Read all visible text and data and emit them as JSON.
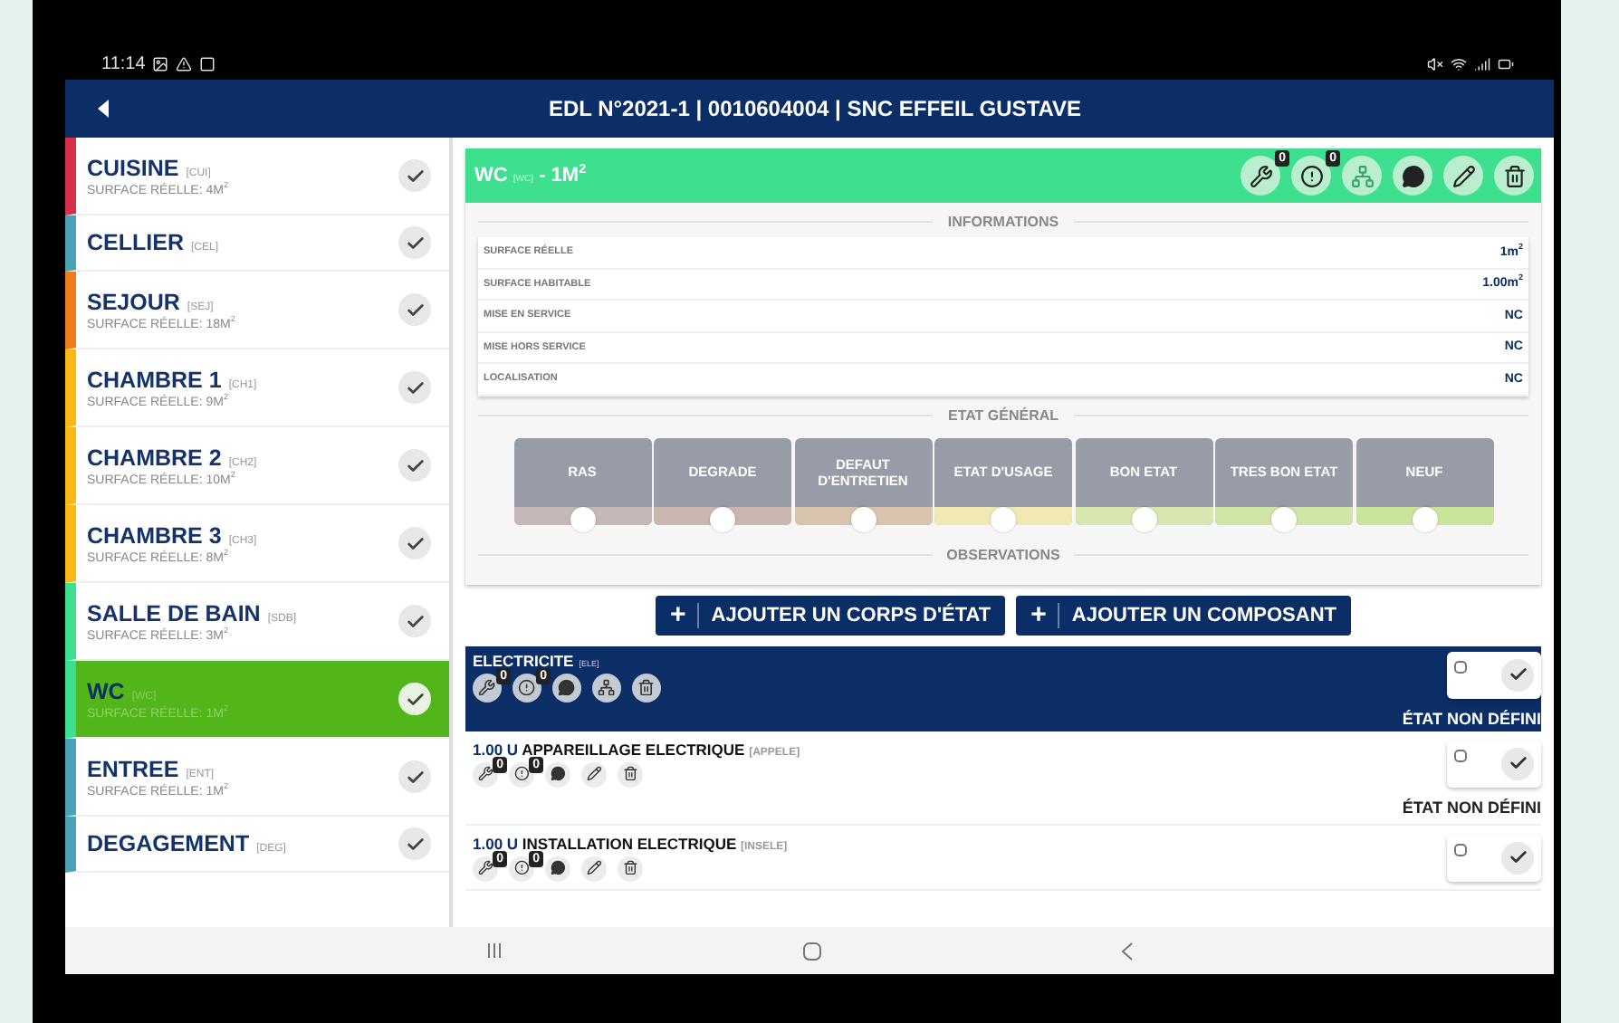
{
  "status_bar": {
    "time": "11:14"
  },
  "header": {
    "title": "EDL N°2021-1 | 0010604004 | SNC EFFEIL GUSTAVE"
  },
  "rooms": [
    {
      "name": "CUISINE",
      "code": "[CUI]",
      "surface": "SURFACE RÉELLE: 4M$^{2}$",
      "color": "#d9304a",
      "selected": false
    },
    {
      "name": "CELLIER",
      "code": "[CEL]",
      "color": "#4aa3b5",
      "selected": false
    },
    {
      "name": "SEJOUR",
      "code": "[SEJ]",
      "surface": "SURFACE RÉELLE: 18M$^{2}$",
      "color": "#f07d1c",
      "selected": false
    },
    {
      "name": "CHAMBRE 1",
      "code": "[CH1]",
      "surface": "SURFACE RÉELLE: 9M$^{2}$",
      "color": "#f7b917",
      "selected": false
    },
    {
      "name": "CHAMBRE 2",
      "code": "[CH2]",
      "surface": "SURFACE RÉELLE: 10M$^{2}$",
      "color": "#f7b917",
      "selected": false
    },
    {
      "name": "CHAMBRE 3",
      "code": "[CH3]",
      "surface": "SURFACE RÉELLE: 8M$^{2}$",
      "color": "#f7b917",
      "selected": false
    },
    {
      "name": "SALLE DE BAIN",
      "code": "[SDB]",
      "surface": "SURFACE RÉELLE: 3M$^{2}$",
      "color": "#3ee08f",
      "selected": false
    },
    {
      "name": "WC",
      "code": "[WC]",
      "surface": "SURFACE RÉELLE: 1M$^{2}$",
      "color": "#3ee08f",
      "selected": true
    },
    {
      "name": "ENTREE",
      "code": "[ENT]",
      "surface": "SURFACE RÉELLE: 1M$^{2}$",
      "color": "#4aa3b5",
      "selected": false
    },
    {
      "name": "DEGAGEMENT",
      "code": "[DEG]",
      "color": "#4aa3b5",
      "selected": false
    }
  ],
  "room_detail": {
    "name": "WC",
    "code": "[WC]",
    "area": "- 1M$^{2}$",
    "badges": [
      "0",
      "0"
    ],
    "information_title": "INFORMATIONS",
    "information": [
      {
        "label": "SURFACE RÉELLE",
        "value": "1m$^{2}$"
      },
      {
        "label": "SURFACE HABITABLE",
        "value": "1.00m$^{2}$"
      },
      {
        "label": "MISE EN SERVICE",
        "value": "NC"
      },
      {
        "label": "MISE HORS SERVICE",
        "value": "NC"
      },
      {
        "label": "LOCALISATION",
        "value": "NC"
      }
    ],
    "etat_title": "ETAT GÉNÉRAL",
    "etat_options": [
      {
        "label": "RAS",
        "color": "#c3b8b5",
        "selected": false
      },
      {
        "label": "DEGRADE",
        "color": "#c9b6ae",
        "selected": false
      },
      {
        "label": "DEFAUT D'ENTRETIEN",
        "color": "#d8c4ad",
        "selected": false
      },
      {
        "label": "ETAT D'USAGE",
        "color": "#f1e9b3",
        "selected": false
      },
      {
        "label": "BON ETAT",
        "color": "#d8e6b0",
        "selected": false
      },
      {
        "label": "TRES BON ETAT",
        "color": "#cfe5a5",
        "selected": false
      },
      {
        "label": "NEUF",
        "color": "#c8e59a",
        "selected": false
      }
    ],
    "observations_title": "OBSERVATIONS"
  },
  "actions": [
    {
      "icon": "+",
      "label": "AJOUTER UN CORPS D'ÉTAT"
    },
    {
      "icon": "+",
      "label": "AJOUTER UN COMPOSANT"
    }
  ],
  "corps": {
    "name": "ELECTRICITE",
    "code": "[ELE]",
    "badges": [
      "0",
      "0"
    ],
    "checked": false,
    "status": "ÉTAT NON DÉFINI",
    "components": [
      {
        "quantity": "1.00 U",
        "name": "APPAREILLAGE ELECTRIQUE",
        "code": "[APPELE]",
        "badges": [
          "0",
          "0"
        ],
        "checked": false,
        "status": "ÉTAT NON DÉFINI"
      },
      {
        "quantity": "1.00 U",
        "name": "INSTALLATION ELECTRIQUE",
        "code": "[INSELE]",
        "badges": [
          "0",
          "0"
        ],
        "checked": false
      }
    ]
  }
}
